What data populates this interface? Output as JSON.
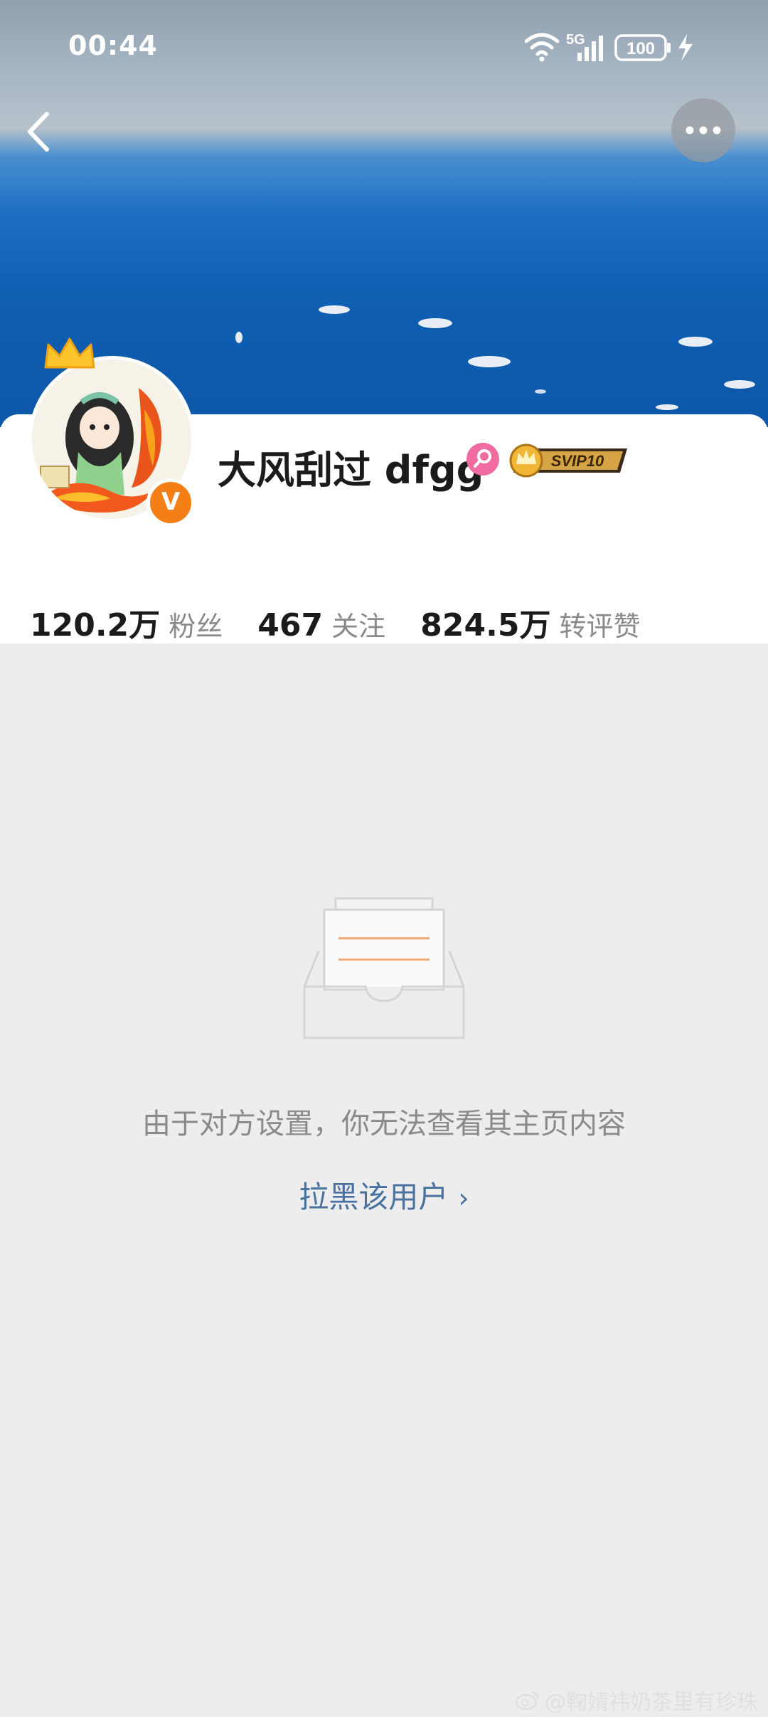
{
  "status_bar": {
    "time": "00:44",
    "network": "5G",
    "battery": "100",
    "icons": [
      "wifi-icon",
      "signal-icon",
      "battery-icon",
      "charging-icon"
    ]
  },
  "header": {
    "back_icon": "chevron-left-icon",
    "more_icon": "more-dots-icon"
  },
  "profile": {
    "username": "大风刮过 dfgg",
    "verified_badge": "V",
    "gender_icon": "female-icon",
    "vip_badge": "SVIP10",
    "stats": [
      {
        "num": "120.2万",
        "label": "粉丝"
      },
      {
        "num": "467",
        "label": "关注"
      },
      {
        "num": "824.5万",
        "label": "转评赞"
      }
    ]
  },
  "main": {
    "empty_message": "由于对方设置，你无法查看其主页内容",
    "block_link": "拉黑该用户",
    "block_chevron": "›"
  },
  "watermark": {
    "text": "@鞠婧祎奶茶里有珍珠"
  },
  "colors": {
    "page_bg": "#ededed",
    "link": "#4a72a0",
    "verified": "#f57f17",
    "female": "#f06ba0"
  }
}
